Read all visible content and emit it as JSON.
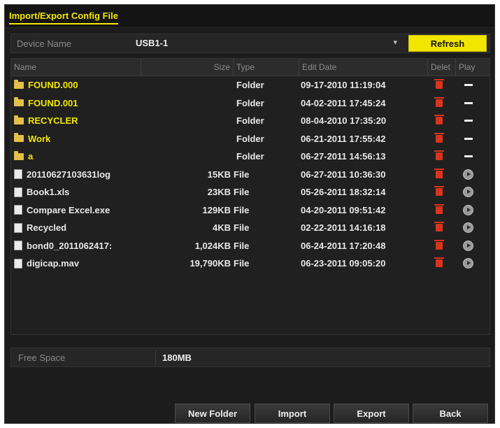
{
  "window": {
    "title": "Import/Export Config File"
  },
  "device": {
    "label": "Device Name",
    "value": "USB1-1",
    "refresh_label": "Refresh"
  },
  "table": {
    "headers": {
      "name": "Name",
      "size": "Size",
      "type": "Type",
      "date": "Edit Date",
      "delete": "Delet",
      "play": "Play"
    },
    "rows": [
      {
        "name": "FOUND.000",
        "size": "",
        "type": "Folder",
        "date": "09-17-2010 11:19:04",
        "kind": "folder"
      },
      {
        "name": "FOUND.001",
        "size": "",
        "type": "Folder",
        "date": "04-02-2011 17:45:24",
        "kind": "folder"
      },
      {
        "name": "RECYCLER",
        "size": "",
        "type": "Folder",
        "date": "08-04-2010 17:35:20",
        "kind": "folder"
      },
      {
        "name": "Work",
        "size": "",
        "type": "Folder",
        "date": "06-21-2011 17:55:42",
        "kind": "folder"
      },
      {
        "name": "a",
        "size": "",
        "type": "Folder",
        "date": "06-27-2011 14:56:13",
        "kind": "folder"
      },
      {
        "name": "20110627103631log",
        "size": "15KB",
        "type": "File",
        "date": "06-27-2011 10:36:30",
        "kind": "file"
      },
      {
        "name": "Book1.xls",
        "size": "23KB",
        "type": "File",
        "date": "05-26-2011 18:32:14",
        "kind": "file"
      },
      {
        "name": "Compare Excel.exe",
        "size": "129KB",
        "type": "File",
        "date": "04-20-2011 09:51:42",
        "kind": "file"
      },
      {
        "name": "Recycled",
        "size": "4KB",
        "type": "File",
        "date": "02-22-2011 14:16:18",
        "kind": "file"
      },
      {
        "name": "bond0_2011062417:",
        "size": "1,024KB",
        "type": "File",
        "date": "06-24-2011 17:20:48",
        "kind": "file"
      },
      {
        "name": "digicap.mav",
        "size": "19,790KB",
        "type": "File",
        "date": "06-23-2011 09:05:20",
        "kind": "file"
      }
    ]
  },
  "free_space": {
    "label": "Free Space",
    "value": "180MB"
  },
  "buttons": {
    "new_folder": "New Folder",
    "import": "Import",
    "export": "Export",
    "back": "Back"
  },
  "icons": {
    "folder": "folder-icon",
    "file": "file-icon",
    "delete": "trash-icon",
    "folder_play": "dash-icon",
    "file_play": "play-icon",
    "select": "chevron-down-icon"
  },
  "colors": {
    "accent": "#f2e600",
    "background": "#1c1c1c",
    "delete": "#d9341d"
  }
}
